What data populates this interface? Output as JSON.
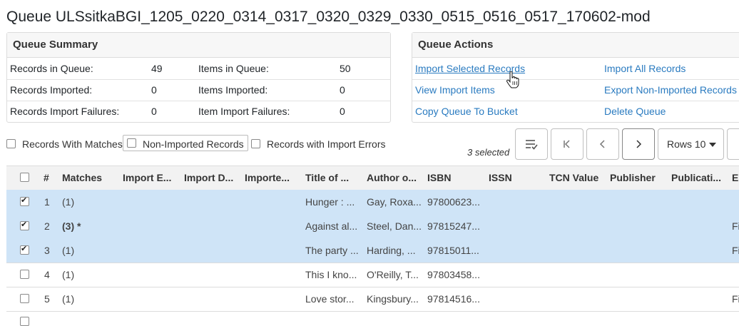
{
  "page_title": "Queue ULSsitkaBGI_1205_0220_0314_0317_0320_0329_0330_0515_0516_0517_170602-mod",
  "summary": {
    "heading": "Queue Summary",
    "rows": [
      {
        "l1": "Records in Queue:",
        "v1": "49",
        "l2": "Items in Queue:",
        "v2": "50"
      },
      {
        "l1": "Records Imported:",
        "v1": "0",
        "l2": "Items Imported:",
        "v2": "0"
      },
      {
        "l1": "Records Import Failures:",
        "v1": "0",
        "l2": "Item Import Failures:",
        "v2": "0"
      }
    ]
  },
  "actions": {
    "heading": "Queue Actions",
    "import_selected": "Import Selected Records",
    "import_all": "Import All Records",
    "view_items": "View Import Items",
    "export_non_imported": "Export Non-Imported Records",
    "copy_to_bucket": "Copy Queue To Bucket",
    "delete_queue": "Delete Queue"
  },
  "filters": {
    "with_matches": "Records With Matches",
    "non_imported": "Non-Imported Records",
    "with_errors": "Records with Import Errors"
  },
  "toolbar": {
    "selected_count": "3 selected",
    "rows_label": "Rows 10",
    "first_icon": "first-page-icon",
    "prev_icon": "previous-page-icon",
    "next_icon": "next-page-icon",
    "column_config_icon": "column-config-icon"
  },
  "grid": {
    "headers": [
      "#",
      "Matches",
      "Import E...",
      "Import D...",
      "Importe...",
      "Title of ...",
      "Author o...",
      "ISBN",
      "ISSN",
      "TCN Value",
      "Publisher",
      "Publicati...",
      "E"
    ],
    "rows": [
      {
        "num": "1",
        "matches": "(1)",
        "title": "Hunger : ...",
        "author": "Gay, Roxa...",
        "isbn": "97800623...",
        "edition": "",
        "checked": true
      },
      {
        "num": "2",
        "matches": "(3) *",
        "title": "Against al...",
        "author": "Steel, Dan...",
        "isbn": "97815247...",
        "edition": "Fi",
        "checked": true
      },
      {
        "num": "3",
        "matches": "(1)",
        "title": "The party ...",
        "author": "Harding, ...",
        "isbn": "97815011...",
        "edition": "Fi",
        "checked": true
      },
      {
        "num": "4",
        "matches": "(1)",
        "title": "This I kno...",
        "author": "O'Reilly, T...",
        "isbn": "97803458...",
        "edition": "",
        "checked": false
      },
      {
        "num": "5",
        "matches": "(1)",
        "title": "Love stor...",
        "author": "Kingsbury...",
        "isbn": "97814516...",
        "edition": "Fi",
        "checked": false
      }
    ]
  },
  "colors": {
    "link": "#2a7bc0",
    "selected_row": "#cfe4f7"
  }
}
